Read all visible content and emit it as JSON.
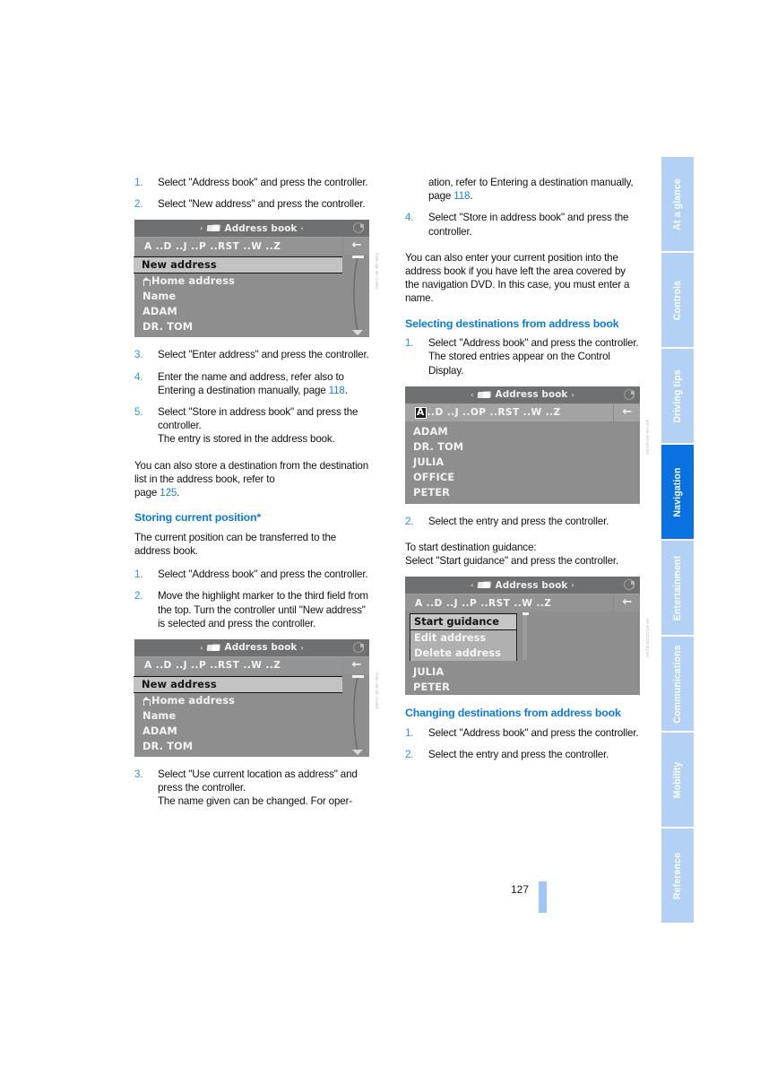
{
  "page": {
    "number": "127"
  },
  "sidebar": {
    "tabs": [
      {
        "label": "At a glance",
        "active": false
      },
      {
        "label": "Controls",
        "active": false
      },
      {
        "label": "Driving tips",
        "active": false
      },
      {
        "label": "Navigation",
        "active": true
      },
      {
        "label": "Entertainment",
        "active": false
      },
      {
        "label": "Communications",
        "active": false
      },
      {
        "label": "Mobility",
        "active": false
      },
      {
        "label": "Reference",
        "active": false
      }
    ],
    "active_color": "#0a72e0",
    "inactive_color": "#b3d0f5"
  },
  "left_column": {
    "steps_top": [
      {
        "num": "1.",
        "text": "Select \"Address book\" and press the controller."
      },
      {
        "num": "2.",
        "text": "Select \"New address\" and press the controller."
      }
    ],
    "figure1": {
      "title": "Address book",
      "alphabet": "A ..D ..J ..P ..RST ..W ..Z",
      "selected_row": "New address",
      "rows": [
        "Home address",
        "Name",
        "ADAM",
        "DR. TOM"
      ],
      "code": "OBFC-JE-BF-NAV"
    },
    "steps_mid": [
      {
        "num": "3.",
        "text": "Select \"Enter address\" and press the controller."
      },
      {
        "num": "4.",
        "text": "Enter the name and address, refer also to Entering a destination manually, page ",
        "xref": "118",
        "after": "."
      },
      {
        "num": "5.",
        "text": "Select \"Store in address book\" and press the controller.",
        "sub": "The entry is stored in the address book."
      }
    ],
    "note1_a": "You can also store a destination from the destination list in the address book, refer to",
    "note1_b": "page ",
    "note1_xref": "125",
    "note1_c": ".",
    "heading_storing": "Storing current position*",
    "storing_intro": "The current position can be transferred to the address book.",
    "steps_storing": [
      {
        "num": "1.",
        "text": "Select \"Address book\" and press the controller."
      },
      {
        "num": "2.",
        "text": "Move the highlight marker to the third field from the top. Turn the controller until \"New address\" is selected and press the controller."
      }
    ],
    "figure2": {
      "title": "Address book",
      "alphabet": "A ..D ..J ..P ..RST ..W ..Z",
      "selected_row": "New address",
      "rows": [
        "Home address",
        "Name",
        "ADAM",
        "DR. TOM"
      ],
      "code": "OBFC-JE-BF-NAV"
    },
    "steps_bottom": [
      {
        "num": "3.",
        "text": "Select \"Use current location as address\" and press the controller.",
        "sub": "The name given can be changed. For oper-"
      }
    ]
  },
  "right_column": {
    "cont_text_a": "ation, refer to Entering a destination manually, page ",
    "cont_xref": "118",
    "cont_text_b": ".",
    "steps_top": [
      {
        "num": "4.",
        "text": "Select \"Store in address book\" and press the controller."
      }
    ],
    "note2": "You can also enter your current position into the address book if you have left the area covered by the navigation DVD. In this case, you must enter a name.",
    "heading_selecting": "Selecting destinations from address book",
    "steps_selecting": [
      {
        "num": "1.",
        "text": "Select \"Address book\" and press the controller.",
        "sub": "The stored entries appear on the Control Display."
      }
    ],
    "figure3": {
      "title": "Address book",
      "alpha_selected": "A",
      "alphabet": "..D ..J ..OP ..RST ..W ..Z",
      "rows": [
        "ADAM",
        "DR. TOM",
        "JULIA",
        "OFFICE",
        "PETER"
      ],
      "code": "VETB-UE-RV-AR"
    },
    "steps_selecting2": [
      {
        "num": "2.",
        "text": "Select the entry and press the controller."
      }
    ],
    "guidance_line1": "To start destination guidance:",
    "guidance_line2": "Select \"Start guidance\" and press the controller.",
    "figure4": {
      "title": "Address book",
      "alphabet": "A ..D ..J ..P ..RST ..W ..Z",
      "popup_selected": "Start guidance",
      "popup_rows": [
        "Edit address",
        "Delete address"
      ],
      "rows": [
        "JULIA",
        "PETER"
      ],
      "code": "VETB-BZDCZN-NA"
    },
    "heading_changing": "Changing destinations from address book",
    "steps_changing": [
      {
        "num": "1.",
        "text": "Select \"Address book\" and press the controller."
      },
      {
        "num": "2.",
        "text": "Select the entry and press the controller."
      }
    ]
  },
  "icons": {
    "book": "address-book-icon",
    "globe": "globe-icon",
    "back": "back-arrow-icon",
    "home": "home-icon",
    "arrow_left": "‹",
    "arrow_right": "›",
    "back_glyph": "←"
  }
}
